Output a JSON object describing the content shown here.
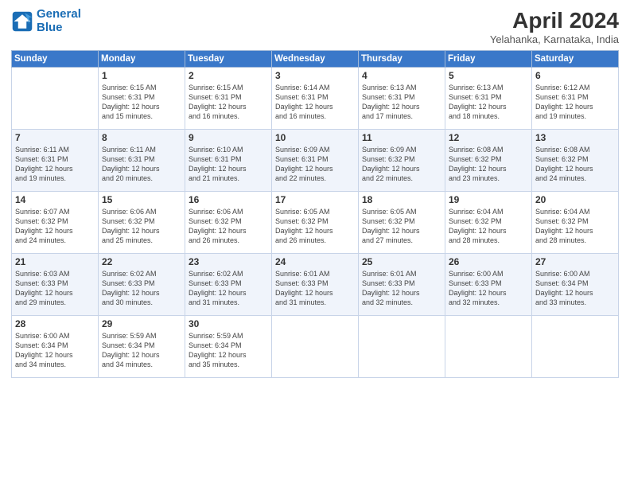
{
  "logo": {
    "line1": "General",
    "line2": "Blue"
  },
  "title": "April 2024",
  "location": "Yelahanka, Karnataka, India",
  "headers": [
    "Sunday",
    "Monday",
    "Tuesday",
    "Wednesday",
    "Thursday",
    "Friday",
    "Saturday"
  ],
  "weeks": [
    [
      {
        "day": "",
        "info": ""
      },
      {
        "day": "1",
        "info": "Sunrise: 6:15 AM\nSunset: 6:31 PM\nDaylight: 12 hours\nand 15 minutes."
      },
      {
        "day": "2",
        "info": "Sunrise: 6:15 AM\nSunset: 6:31 PM\nDaylight: 12 hours\nand 16 minutes."
      },
      {
        "day": "3",
        "info": "Sunrise: 6:14 AM\nSunset: 6:31 PM\nDaylight: 12 hours\nand 16 minutes."
      },
      {
        "day": "4",
        "info": "Sunrise: 6:13 AM\nSunset: 6:31 PM\nDaylight: 12 hours\nand 17 minutes."
      },
      {
        "day": "5",
        "info": "Sunrise: 6:13 AM\nSunset: 6:31 PM\nDaylight: 12 hours\nand 18 minutes."
      },
      {
        "day": "6",
        "info": "Sunrise: 6:12 AM\nSunset: 6:31 PM\nDaylight: 12 hours\nand 19 minutes."
      }
    ],
    [
      {
        "day": "7",
        "info": "Sunrise: 6:11 AM\nSunset: 6:31 PM\nDaylight: 12 hours\nand 19 minutes."
      },
      {
        "day": "8",
        "info": "Sunrise: 6:11 AM\nSunset: 6:31 PM\nDaylight: 12 hours\nand 20 minutes."
      },
      {
        "day": "9",
        "info": "Sunrise: 6:10 AM\nSunset: 6:31 PM\nDaylight: 12 hours\nand 21 minutes."
      },
      {
        "day": "10",
        "info": "Sunrise: 6:09 AM\nSunset: 6:31 PM\nDaylight: 12 hours\nand 22 minutes."
      },
      {
        "day": "11",
        "info": "Sunrise: 6:09 AM\nSunset: 6:32 PM\nDaylight: 12 hours\nand 22 minutes."
      },
      {
        "day": "12",
        "info": "Sunrise: 6:08 AM\nSunset: 6:32 PM\nDaylight: 12 hours\nand 23 minutes."
      },
      {
        "day": "13",
        "info": "Sunrise: 6:08 AM\nSunset: 6:32 PM\nDaylight: 12 hours\nand 24 minutes."
      }
    ],
    [
      {
        "day": "14",
        "info": "Sunrise: 6:07 AM\nSunset: 6:32 PM\nDaylight: 12 hours\nand 24 minutes."
      },
      {
        "day": "15",
        "info": "Sunrise: 6:06 AM\nSunset: 6:32 PM\nDaylight: 12 hours\nand 25 minutes."
      },
      {
        "day": "16",
        "info": "Sunrise: 6:06 AM\nSunset: 6:32 PM\nDaylight: 12 hours\nand 26 minutes."
      },
      {
        "day": "17",
        "info": "Sunrise: 6:05 AM\nSunset: 6:32 PM\nDaylight: 12 hours\nand 26 minutes."
      },
      {
        "day": "18",
        "info": "Sunrise: 6:05 AM\nSunset: 6:32 PM\nDaylight: 12 hours\nand 27 minutes."
      },
      {
        "day": "19",
        "info": "Sunrise: 6:04 AM\nSunset: 6:32 PM\nDaylight: 12 hours\nand 28 minutes."
      },
      {
        "day": "20",
        "info": "Sunrise: 6:04 AM\nSunset: 6:32 PM\nDaylight: 12 hours\nand 28 minutes."
      }
    ],
    [
      {
        "day": "21",
        "info": "Sunrise: 6:03 AM\nSunset: 6:33 PM\nDaylight: 12 hours\nand 29 minutes."
      },
      {
        "day": "22",
        "info": "Sunrise: 6:02 AM\nSunset: 6:33 PM\nDaylight: 12 hours\nand 30 minutes."
      },
      {
        "day": "23",
        "info": "Sunrise: 6:02 AM\nSunset: 6:33 PM\nDaylight: 12 hours\nand 31 minutes."
      },
      {
        "day": "24",
        "info": "Sunrise: 6:01 AM\nSunset: 6:33 PM\nDaylight: 12 hours\nand 31 minutes."
      },
      {
        "day": "25",
        "info": "Sunrise: 6:01 AM\nSunset: 6:33 PM\nDaylight: 12 hours\nand 32 minutes."
      },
      {
        "day": "26",
        "info": "Sunrise: 6:00 AM\nSunset: 6:33 PM\nDaylight: 12 hours\nand 32 minutes."
      },
      {
        "day": "27",
        "info": "Sunrise: 6:00 AM\nSunset: 6:34 PM\nDaylight: 12 hours\nand 33 minutes."
      }
    ],
    [
      {
        "day": "28",
        "info": "Sunrise: 6:00 AM\nSunset: 6:34 PM\nDaylight: 12 hours\nand 34 minutes."
      },
      {
        "day": "29",
        "info": "Sunrise: 5:59 AM\nSunset: 6:34 PM\nDaylight: 12 hours\nand 34 minutes."
      },
      {
        "day": "30",
        "info": "Sunrise: 5:59 AM\nSunset: 6:34 PM\nDaylight: 12 hours\nand 35 minutes."
      },
      {
        "day": "",
        "info": ""
      },
      {
        "day": "",
        "info": ""
      },
      {
        "day": "",
        "info": ""
      },
      {
        "day": "",
        "info": ""
      }
    ]
  ]
}
